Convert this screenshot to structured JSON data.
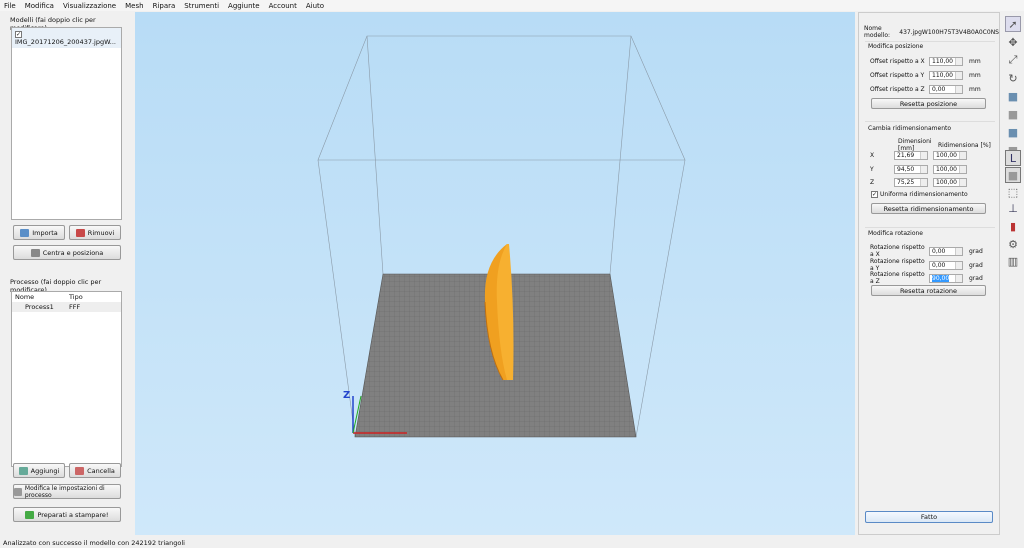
{
  "menu": [
    "File",
    "Modifica",
    "Visualizzazione",
    "Mesh",
    "Ripara",
    "Strumenti",
    "Aggiunte",
    "Account",
    "Aiuto"
  ],
  "models": {
    "label": "Modelli (fai doppio clic per modificare)",
    "items": [
      "IMG_20171206_200437.jpgW..."
    ],
    "import": "Importa",
    "remove": "Rimuovi",
    "center": "Centra e posiziona"
  },
  "process": {
    "label": "Processo (fai doppio clic per modificare)",
    "col_name": "Nome",
    "col_type": "Tipo",
    "rows": [
      {
        "name": "Process1",
        "type": "FFF"
      }
    ],
    "add": "Aggiungi",
    "delete": "Cancella",
    "settings": "Modifica le impostazioni di processo",
    "prepare": "Preparati a stampare!"
  },
  "right": {
    "name_label": "Nome modello:",
    "name_value": "437.jpgW100H75T3V4B0A0C0NS",
    "pos": {
      "title": "Modifica posizione",
      "x_label": "Offset rispetto a X",
      "x": "110,00",
      "y_label": "Offset rispetto a Y",
      "y": "110,00",
      "z_label": "Offset rispetto a Z",
      "z": "0,00",
      "unit": "mm",
      "reset": "Resetta posizione"
    },
    "scale": {
      "title": "Cambia ridimensionamento",
      "h_dim": "Dimensioni [mm]",
      "h_pct": "Ridimensiona [%]",
      "rows": [
        {
          "axis": "X",
          "dim": "21,69",
          "pct": "100,00"
        },
        {
          "axis": "Y",
          "dim": "94,50",
          "pct": "100,00"
        },
        {
          "axis": "Z",
          "dim": "75,25",
          "pct": "100,00"
        }
      ],
      "uniform": "Uniforma ridimensionamento",
      "reset": "Resetta ridimensionamento"
    },
    "rot": {
      "title": "Modifica rotazione",
      "x_label": "Rotazione rispetto a X",
      "x": "0,00",
      "y_label": "Rotazione rispetto a Y",
      "y": "0,00",
      "z_label": "Rotazione rispetto a Z",
      "z": "90,00",
      "unit": "grad",
      "reset": "Resetta rotazione"
    },
    "done": "Fatto"
  },
  "status": "Analizzato con successo il modello con 242192 triangoli",
  "axis_label": "Z",
  "colors": {
    "model": "#f5a623",
    "plate": "#777777",
    "viewport": "#c4e2f8"
  }
}
